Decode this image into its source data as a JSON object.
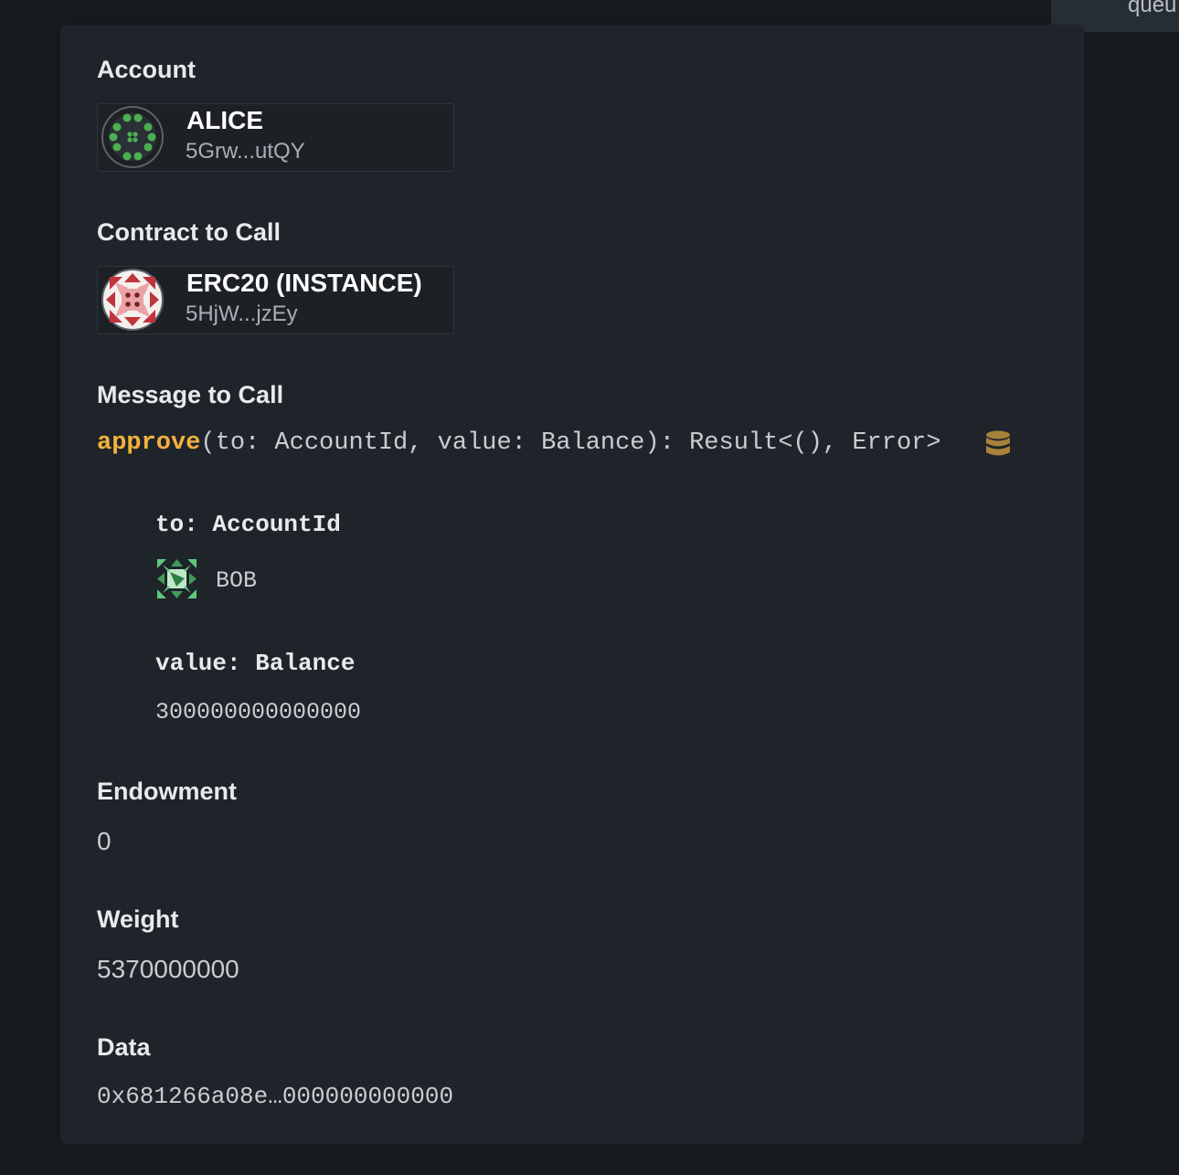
{
  "corner_tab": {
    "label": "queu"
  },
  "account": {
    "label": "Account",
    "name": "ALICE",
    "address": "5Grw...utQY"
  },
  "contract": {
    "label": "Contract to Call",
    "name": "ERC20 (INSTANCE)",
    "address": "5HjW...jzEy"
  },
  "message": {
    "label": "Message to Call",
    "fn_name": "approve",
    "signature_rest": "(to: AccountId, value: Balance): Result<(), Error>",
    "icon": "database-icon",
    "args": [
      {
        "label": "to: AccountId",
        "value": "BOB",
        "icon": "identicon"
      },
      {
        "label": "value: Balance",
        "value": "300000000000000"
      }
    ]
  },
  "endowment": {
    "label": "Endowment",
    "value": "0"
  },
  "weight": {
    "label": "Weight",
    "value": "5370000000"
  },
  "data": {
    "label": "Data",
    "value": "0x681266a08e…000000000000"
  },
  "colors": {
    "background": "#16191d",
    "panel": "#1f242a",
    "function_name": "#f3b13d",
    "db_icon": "#a8813a",
    "alice_avatar": "#4caf50",
    "contract_avatar_red": "#c0343c",
    "contract_avatar_pink": "#e9a3a7",
    "bob_avatar": "#5fc77a"
  }
}
